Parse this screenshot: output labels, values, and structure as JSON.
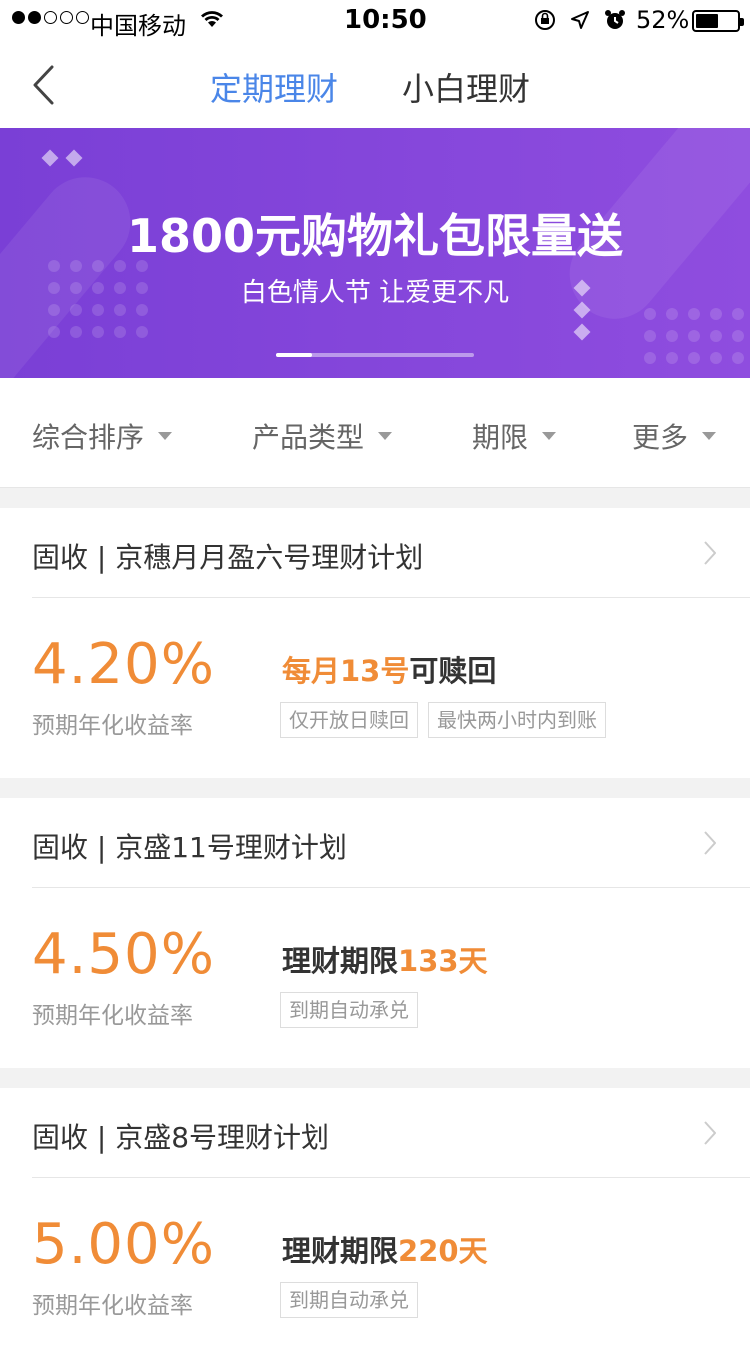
{
  "status_bar": {
    "carrier": "中国移动",
    "time": "10:50",
    "battery_percent": "52%",
    "signal_strength_of_5": 2,
    "battery_level": 0.52
  },
  "nav": {
    "tabs": [
      {
        "label": "定期理财",
        "active": true
      },
      {
        "label": "小白理财",
        "active": false
      }
    ]
  },
  "banner": {
    "title": "1800元购物礼包限量送",
    "subtitle": "白色情人节 让爱更不凡",
    "background_color": "#7a3fd6"
  },
  "filters": [
    {
      "label": "综合排序"
    },
    {
      "label": "产品类型"
    },
    {
      "label": "期限"
    },
    {
      "label": "更多"
    }
  ],
  "products": [
    {
      "title": "固收 | 京穗月月盈六号理财计划",
      "rate": "4.20%",
      "rate_label": "预期年化收益率",
      "detail_highlight": "每月13号",
      "detail_text": "可赎回",
      "tags": [
        "仅开放日赎回",
        "最快两小时内到账"
      ]
    },
    {
      "title": "固收 | 京盛11号理财计划",
      "rate": "4.50%",
      "rate_label": "预期年化收益率",
      "detail_text": "理财期限",
      "detail_highlight": "133天",
      "tags": [
        "到期自动承兑"
      ]
    },
    {
      "title": "固收 | 京盛8号理财计划",
      "rate": "5.00%",
      "rate_label": "预期年化收益率",
      "detail_text": "理财期限",
      "detail_highlight": "220天",
      "tags": [
        "到期自动承兑"
      ]
    }
  ],
  "colors": {
    "accent_orange": "#f08c37",
    "active_tab_blue": "#4a86e8",
    "banner_purple": "#7a3fd6"
  }
}
